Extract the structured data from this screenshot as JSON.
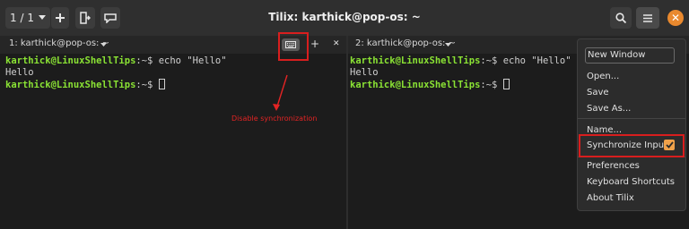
{
  "titlebar": {
    "session_counter": "1 / 1",
    "session_dropdown_icon": "caret-down-icon",
    "add_icon": "plus-icon",
    "new_window_icon": "new-window-icon",
    "rename_icon": "rename-icon",
    "title": "Tilix: karthick@pop-os: ~",
    "search_icon": "search-icon",
    "menu_icon": "hamburger-menu-icon",
    "close_symbol": "✕"
  },
  "left_pane": {
    "tab_label": "1: karthick@pop-os: ~",
    "sync_button_icon": "keyboard-icon",
    "add_symbol": "+",
    "close_symbol": "✕",
    "lines": [
      {
        "prompt": "karthick@LinuxShellTips",
        "suffix": ":~$ echo \"Hello\""
      },
      {
        "text": "Hello"
      },
      {
        "prompt": "karthick@LinuxShellTips",
        "suffix": ":~$ "
      }
    ]
  },
  "right_pane": {
    "tab_label": "2: karthick@pop-os: ~",
    "lines": [
      {
        "prompt": "karthick@LinuxShellTips",
        "suffix": ":~$ echo \"Hello\""
      },
      {
        "text": "Hello"
      },
      {
        "prompt": "karthick@LinuxShellTips",
        "suffix": ":~$ "
      }
    ]
  },
  "annotation": {
    "text": "Disable synchronization",
    "color": "#e32424"
  },
  "menu": {
    "new_window": "New Window",
    "items": [
      "Open...",
      "Save",
      "Save As...",
      "Name...",
      "Synchronize Input",
      "Preferences",
      "Keyboard Shortcuts",
      "About Tilix"
    ],
    "synchronize_input_checked": true
  },
  "colors": {
    "accent": "#f0a14a",
    "prompt": "#8ae234",
    "highlight": "#d81e1e"
  }
}
